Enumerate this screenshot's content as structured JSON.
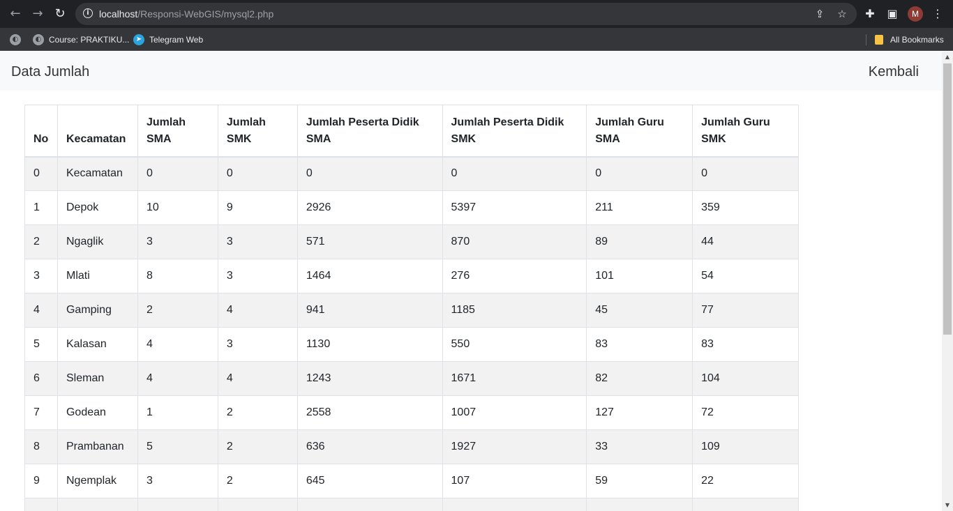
{
  "browser": {
    "url_host": "localhost",
    "url_path": "/Responsi-WebGIS/mysql2.php",
    "profile_initial": "M",
    "bookmarks": [
      {
        "label": "Course: PRAKTIKU...",
        "icon": "globe-icon"
      },
      {
        "label": "Telegram Web",
        "icon": "telegram-icon"
      }
    ],
    "all_bookmarks_label": "All Bookmarks"
  },
  "navbar": {
    "brand": "Data Jumlah",
    "back_link": "Kembali"
  },
  "table": {
    "headers": {
      "h0": "No",
      "h1": "Kecamatan",
      "h2a": "Jumlah",
      "h2b": "SMA",
      "h3a": "Jumlah",
      "h3b": "SMK",
      "h4a": "Jumlah Peserta Didik",
      "h4b": "SMA",
      "h5a": "Jumlah Peserta Didik",
      "h5b": "SMK",
      "h6a": "Jumlah Guru",
      "h6b": "SMA",
      "h7a": "Jumlah Guru",
      "h7b": "SMK"
    },
    "rows": [
      [
        "0",
        "Kecamatan",
        "0",
        "0",
        "0",
        "0",
        "0",
        "0"
      ],
      [
        "1",
        "Depok",
        "10",
        "9",
        "2926",
        "5397",
        "211",
        "359"
      ],
      [
        "2",
        "Ngaglik",
        "3",
        "3",
        "571",
        "870",
        "89",
        "44"
      ],
      [
        "3",
        "Mlati",
        "8",
        "3",
        "1464",
        "276",
        "101",
        "54"
      ],
      [
        "4",
        "Gamping",
        "2",
        "4",
        "941",
        "1185",
        "45",
        "77"
      ],
      [
        "5",
        "Kalasan",
        "4",
        "3",
        "1130",
        "550",
        "83",
        "83"
      ],
      [
        "6",
        "Sleman",
        "4",
        "4",
        "1243",
        "1671",
        "82",
        "104"
      ],
      [
        "7",
        "Godean",
        "1",
        "2",
        "2558",
        "1007",
        "127",
        "72"
      ],
      [
        "8",
        "Prambanan",
        "5",
        "2",
        "636",
        "1927",
        "33",
        "109"
      ],
      [
        "9",
        "Ngemplak",
        "3",
        "2",
        "645",
        "107",
        "59",
        "22"
      ]
    ]
  }
}
